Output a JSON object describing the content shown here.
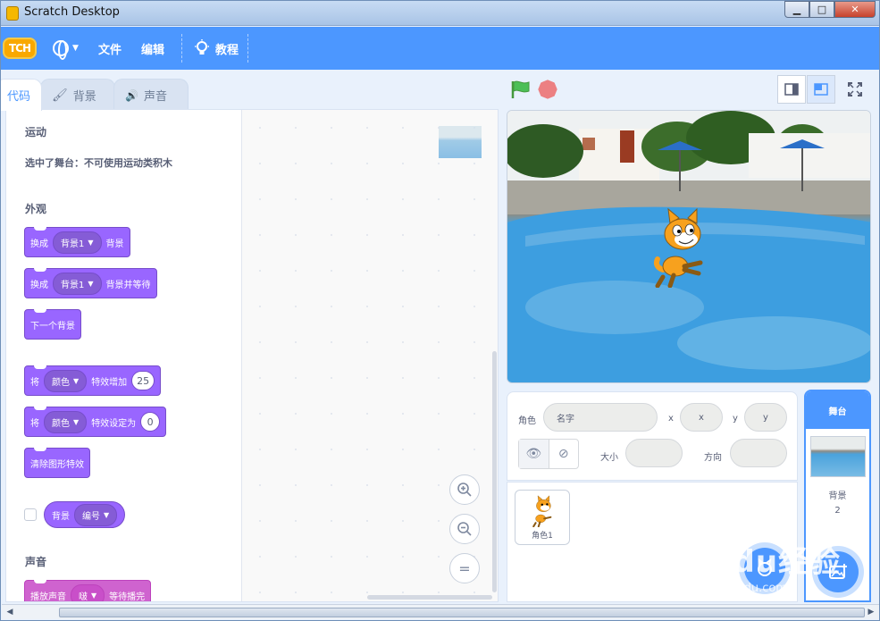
{
  "window": {
    "title": "Scratch Desktop",
    "min": "▁",
    "max": "□",
    "close": "✕"
  },
  "menubar": {
    "logo": "TCH",
    "file": "文件",
    "edit": "编辑",
    "tutorials": "教程"
  },
  "tabs": {
    "code": "代码",
    "costumes": "背景",
    "sounds": "声音"
  },
  "palette": {
    "motion_title": "运动",
    "motion_note": "选中了舞台：不可使用运动类积木",
    "looks_title": "外观",
    "b1": {
      "a": "换成",
      "dd": "背景1",
      "b": "背景"
    },
    "b2": {
      "a": "换成",
      "dd": "背景1",
      "b": "背景并等待"
    },
    "b3": {
      "a": "下一个背景"
    },
    "b4": {
      "a": "将",
      "dd": "颜色",
      "b": "特效增加",
      "n": "25"
    },
    "b5": {
      "a": "将",
      "dd": "颜色",
      "b": "特效设定为",
      "n": "0"
    },
    "b6": {
      "a": "清除图形特效"
    },
    "r1": {
      "a": "背景",
      "dd": "编号"
    },
    "sound_title": "声音",
    "s1": {
      "a": "播放声音",
      "dd": "啵",
      "b": "等待播完"
    }
  },
  "zoom": {
    "in": "+",
    "out": "−",
    "reset": "="
  },
  "sprite_info": {
    "sprite_label": "角色",
    "name_placeholder": "名字",
    "x_label": "x",
    "x_value": "x",
    "y_label": "y",
    "y_value": "y",
    "size_label": "大小",
    "direction_label": "方向"
  },
  "sprites": [
    {
      "name": "角色1"
    }
  ],
  "stage_selector": {
    "title": "舞台",
    "backdrop_label": "背景",
    "backdrop_count": "2"
  },
  "watermark": {
    "text": "Baidu经验",
    "url": "jingyan.baidu.com"
  },
  "colors": {
    "accent": "#4c97ff",
    "looks": "#9966ff",
    "sound": "#cf63cf",
    "flag": "#4cbf56",
    "stop": "#ec5959"
  }
}
